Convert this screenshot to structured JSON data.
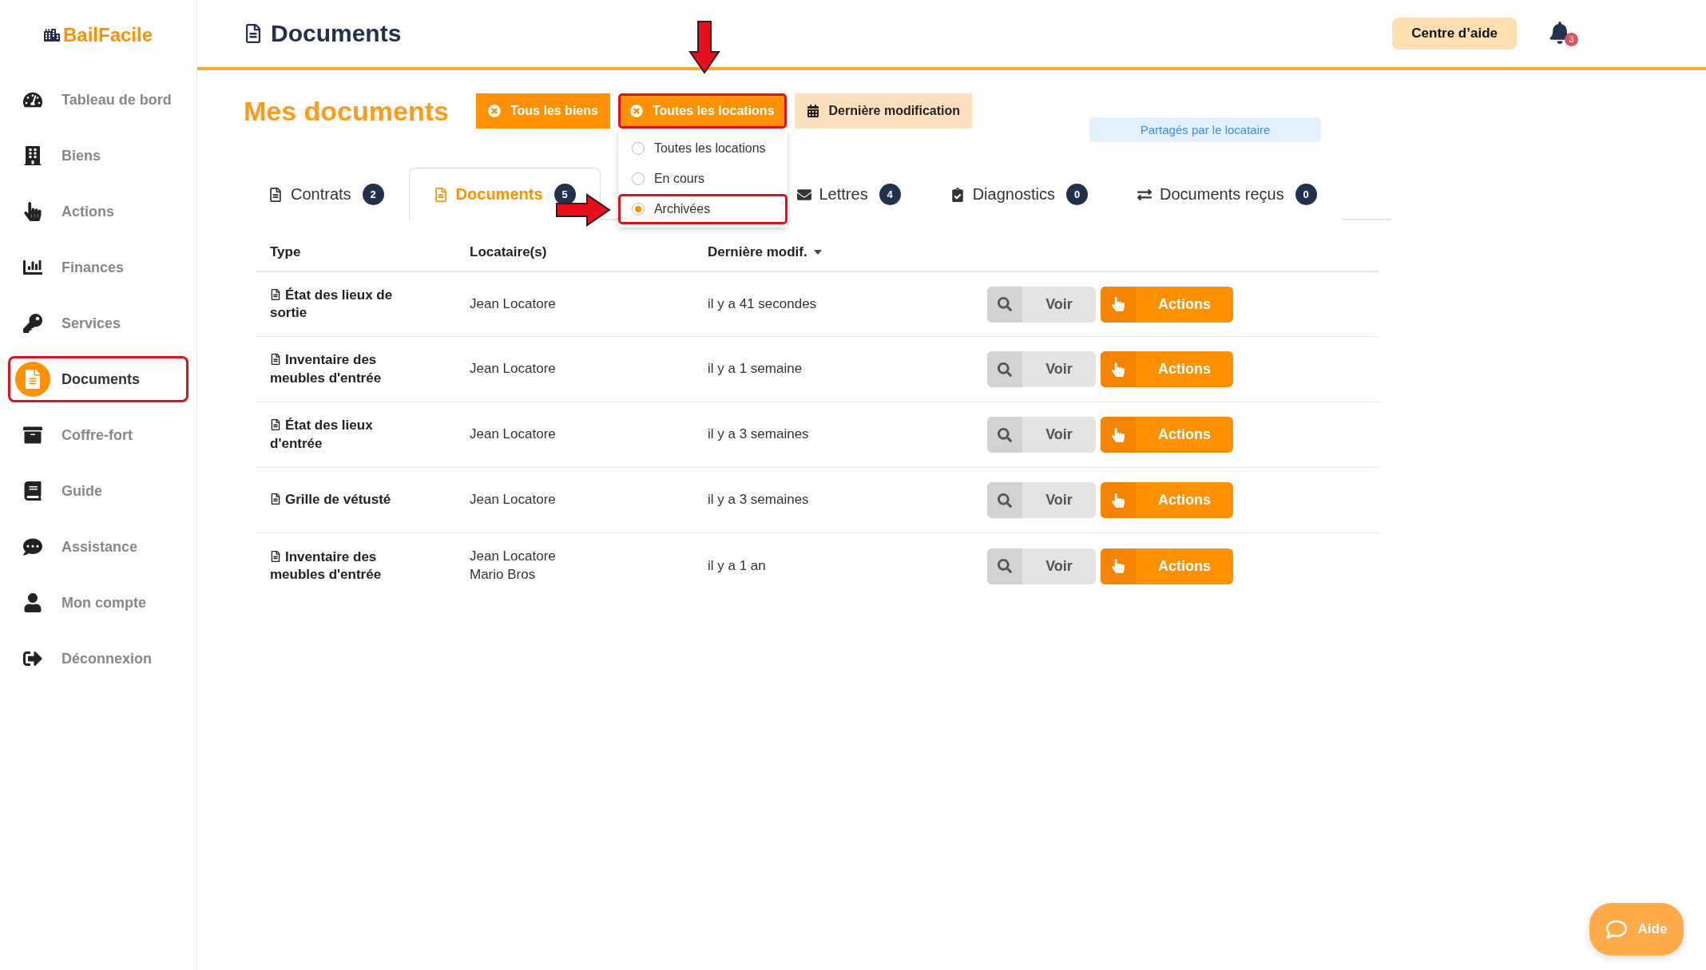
{
  "logo": {
    "text": "BailFacile"
  },
  "sidebar": {
    "items": [
      {
        "label": "Tableau de bord",
        "selected": false,
        "highlighted": false
      },
      {
        "label": "Biens",
        "selected": false,
        "highlighted": false
      },
      {
        "label": "Actions",
        "selected": false,
        "highlighted": false
      },
      {
        "label": "Finances",
        "selected": false,
        "highlighted": false
      },
      {
        "label": "Services",
        "selected": false,
        "highlighted": false
      },
      {
        "label": "Documents",
        "selected": true,
        "highlighted": true
      },
      {
        "label": "Coffre-fort",
        "selected": false,
        "highlighted": false
      },
      {
        "label": "Guide",
        "selected": false,
        "highlighted": false
      },
      {
        "label": "Assistance",
        "selected": false,
        "highlighted": false
      },
      {
        "label": "Mon compte",
        "selected": false,
        "highlighted": false
      },
      {
        "label": "Déconnexion",
        "selected": false,
        "highlighted": false
      }
    ]
  },
  "header": {
    "title": "Documents",
    "help_button": "Centre d’aide",
    "notification_count": "3"
  },
  "page_title": "Mes documents",
  "filters": [
    {
      "label": "Tous les biens",
      "kind": "clear",
      "highlighted": false
    },
    {
      "label": "Toutes les locations",
      "kind": "clear",
      "highlighted": true,
      "options": [
        {
          "label": "Toutes les locations",
          "selected": false,
          "highlighted": false
        },
        {
          "label": "En cours",
          "selected": false,
          "highlighted": false
        },
        {
          "label": "Archivées",
          "selected": true,
          "highlighted": true
        }
      ]
    },
    {
      "label": "Dernière modification",
      "kind": "sort",
      "highlighted": false
    }
  ],
  "shared_badge": "Partagés par le locataire",
  "tabs": [
    {
      "label": "Contrats",
      "count": "2",
      "selected": false
    },
    {
      "label": "Documents",
      "count": "5",
      "selected": true
    },
    {
      "label": "Lettres",
      "count": "4",
      "selected": false
    },
    {
      "label": "Diagnostics",
      "count": "0",
      "selected": false
    },
    {
      "label": "Documents reçus",
      "count": "0",
      "selected": false
    }
  ],
  "table": {
    "columns": [
      {
        "label": "Type",
        "sorted": false
      },
      {
        "label": "Locataire(s)",
        "sorted": false
      },
      {
        "label": "Dernière modif.",
        "sorted": true
      }
    ],
    "rows": [
      {
        "type": "État des lieux de sortie",
        "tenants": [
          "Jean Locatore"
        ],
        "modified": "il y a 41 secondes",
        "view_button": "Voir",
        "actions_button": "Actions"
      },
      {
        "type": "Inventaire des meubles d'entrée",
        "tenants": [
          "Jean Locatore"
        ],
        "modified": "il y a 1 semaine",
        "view_button": "Voir",
        "actions_button": "Actions"
      },
      {
        "type": "État des lieux d'entrée",
        "tenants": [
          "Jean Locatore"
        ],
        "modified": "il y a 3 semaines",
        "view_button": "Voir",
        "actions_button": "Actions"
      },
      {
        "type": "Grille de vétusté",
        "tenants": [
          "Jean Locatore"
        ],
        "modified": "il y a 3 semaines",
        "view_button": "Voir",
        "actions_button": "Actions"
      },
      {
        "type": "Inventaire des meubles d'entrée",
        "tenants": [
          "Jean Locatore",
          "Mario Bros"
        ],
        "modified": "il y a 1 an",
        "view_button": "Voir",
        "actions_button": "Actions"
      }
    ]
  },
  "help_fab": "Aide"
}
